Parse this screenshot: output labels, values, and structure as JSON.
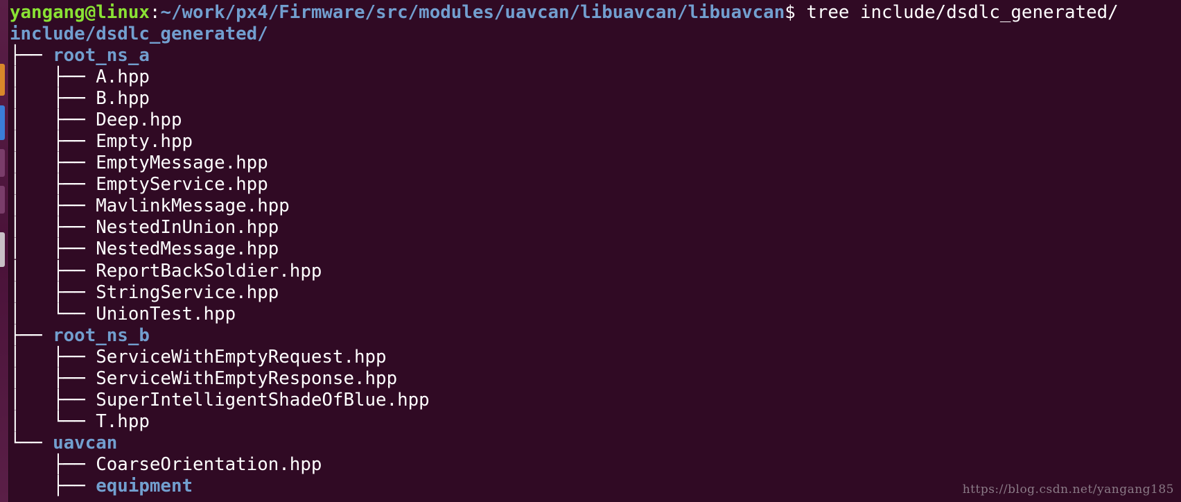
{
  "terminal": {
    "prompt": {
      "user_host": "yangang@linux",
      "colon": ":",
      "path": "~/work/px4/Firmware/src/modules/uavcan/libuavcan/libuavcan",
      "dollar": "$ ",
      "command": "tree include/dsdlc_generated/"
    },
    "root_dir": "include/dsdlc_generated/",
    "tree": [
      {
        "prefix": "├── ",
        "name": "root_ns_a",
        "kind": "dir"
      },
      {
        "prefix": "│   ├── ",
        "name": "A.hpp",
        "kind": "file"
      },
      {
        "prefix": "│   ├── ",
        "name": "B.hpp",
        "kind": "file"
      },
      {
        "prefix": "│   ├── ",
        "name": "Deep.hpp",
        "kind": "file"
      },
      {
        "prefix": "│   ├── ",
        "name": "Empty.hpp",
        "kind": "file"
      },
      {
        "prefix": "│   ├── ",
        "name": "EmptyMessage.hpp",
        "kind": "file"
      },
      {
        "prefix": "│   ├── ",
        "name": "EmptyService.hpp",
        "kind": "file"
      },
      {
        "prefix": "│   ├── ",
        "name": "MavlinkMessage.hpp",
        "kind": "file"
      },
      {
        "prefix": "│   ├── ",
        "name": "NestedInUnion.hpp",
        "kind": "file"
      },
      {
        "prefix": "│   ├── ",
        "name": "NestedMessage.hpp",
        "kind": "file"
      },
      {
        "prefix": "│   ├── ",
        "name": "ReportBackSoldier.hpp",
        "kind": "file"
      },
      {
        "prefix": "│   ├── ",
        "name": "StringService.hpp",
        "kind": "file"
      },
      {
        "prefix": "│   └── ",
        "name": "UnionTest.hpp",
        "kind": "file"
      },
      {
        "prefix": "├── ",
        "name": "root_ns_b",
        "kind": "dir"
      },
      {
        "prefix": "│   ├── ",
        "name": "ServiceWithEmptyRequest.hpp",
        "kind": "file"
      },
      {
        "prefix": "│   ├── ",
        "name": "ServiceWithEmptyResponse.hpp",
        "kind": "file"
      },
      {
        "prefix": "│   ├── ",
        "name": "SuperIntelligentShadeOfBlue.hpp",
        "kind": "file"
      },
      {
        "prefix": "│   └── ",
        "name": "T.hpp",
        "kind": "file"
      },
      {
        "prefix": "└── ",
        "name": "uavcan",
        "kind": "dir"
      },
      {
        "prefix": "    ├── ",
        "name": "CoarseOrientation.hpp",
        "kind": "file"
      },
      {
        "prefix": "    ├── ",
        "name": "equipment",
        "kind": "dir"
      }
    ],
    "watermark": "https://blog.csdn.net/yangang185"
  },
  "colors": {
    "background": "#300a24",
    "prompt_user": "#8ae234",
    "directory": "#729fcf",
    "text": "#ffffff"
  }
}
